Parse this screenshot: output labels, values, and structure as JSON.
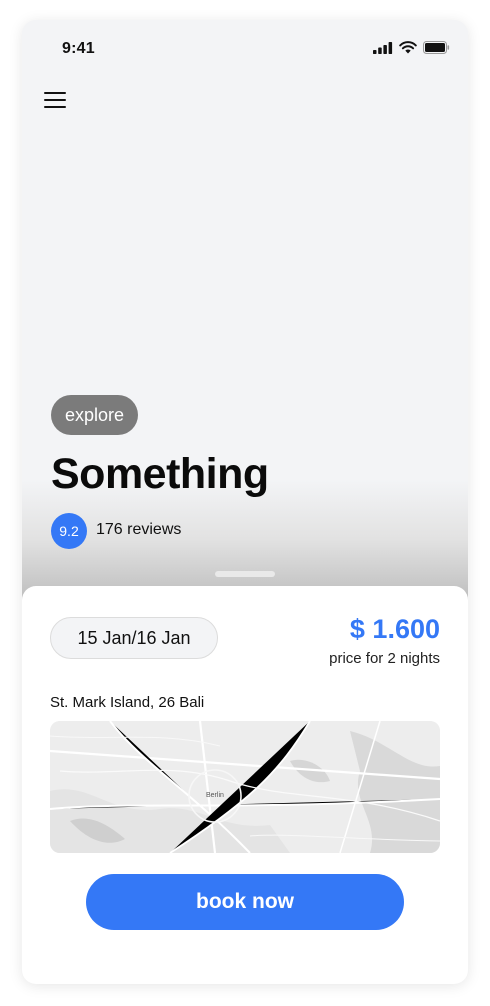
{
  "status_bar": {
    "time": "9:41"
  },
  "hero": {
    "tag": "explore",
    "title": "Something",
    "rating": "9.2",
    "reviews": "176 reviews"
  },
  "booking": {
    "dates": "15 Jan/16 Jan",
    "price": "$ 1.600",
    "price_note": "price for 2 nights",
    "address": "St. Mark Island, 26 Bali",
    "map_city_label": "Berlin",
    "book_label": "book now"
  },
  "colors": {
    "accent": "#3478f6",
    "tag_bg": "#7b7b7b",
    "sheet_bg": "#ffffff",
    "hero_bg": "#f3f4f6"
  },
  "icons": [
    "cellular-signal-icon",
    "wifi-icon",
    "battery-icon",
    "hamburger-menu-icon"
  ]
}
